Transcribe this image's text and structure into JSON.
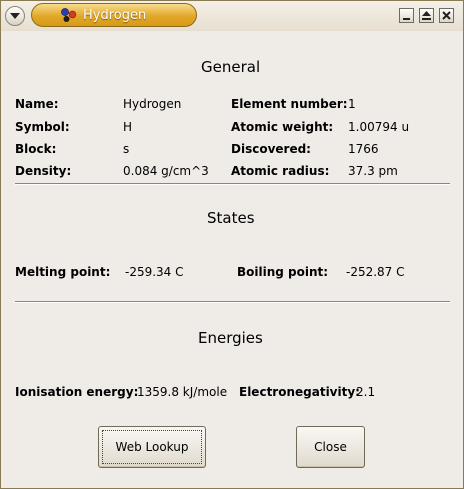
{
  "window": {
    "title": "Hydrogen"
  },
  "general": {
    "heading": "General",
    "name_label": "Name:",
    "name_value": "Hydrogen",
    "symbol_label": "Symbol:",
    "symbol_value": "H",
    "block_label": "Block:",
    "block_value": "s",
    "density_label": "Density:",
    "density_value": "0.084 g/cm^3",
    "element_number_label": "Element number:",
    "element_number_value": "1",
    "atomic_weight_label": "Atomic weight:",
    "atomic_weight_value": "1.00794 u",
    "discovered_label": "Discovered:",
    "discovered_value": "1766",
    "atomic_radius_label": "Atomic radius:",
    "atomic_radius_value": "37.3 pm"
  },
  "states": {
    "heading": "States",
    "melting_label": "Melting point:",
    "melting_value": "-259.34 C",
    "boiling_label": "Boiling point:",
    "boiling_value": "-252.87 C"
  },
  "energies": {
    "heading": "Energies",
    "ionisation_label": "Ionisation energy:",
    "ionisation_value": "1359.8 kJ/mole",
    "electronegativity_label": "Electronegativity:",
    "electronegativity_value": "2.1"
  },
  "buttons": {
    "web_lookup": "Web Lookup",
    "close": "Close"
  },
  "icons": {
    "window_menu": "chevron-down-icon",
    "app": "molecule-icon",
    "minimize": "minimize-icon",
    "maximize": "maximize-icon",
    "close": "close-icon"
  },
  "colors": {
    "title_accent": "#e1a829",
    "window_bg": "#efebe7"
  }
}
